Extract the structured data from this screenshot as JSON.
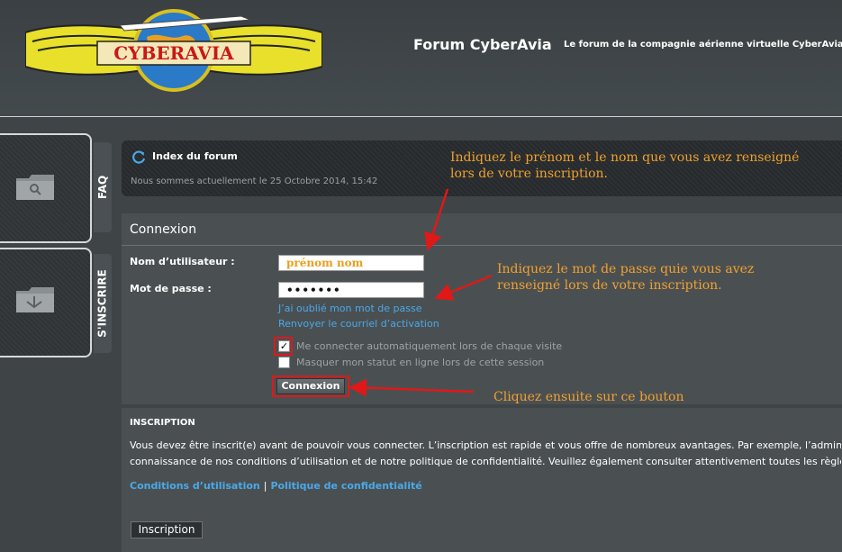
{
  "header": {
    "logo_text": "CYBERAVIA",
    "site_title": "Forum CyberAvia",
    "site_description": "Le forum de la compagnie aérienne virtuelle CyberAvia"
  },
  "side_tabs": [
    {
      "label": "FAQ",
      "icon": "search-folder-icon"
    },
    {
      "label": "S'INSCRIRE",
      "icon": "inbox-folder-icon"
    }
  ],
  "nav": {
    "icon": "refresh-icon",
    "index_link": "Index du forum",
    "date_text": "Nous sommes actuellement le 25 Octobre 2014, 15:42"
  },
  "login": {
    "title": "Connexion",
    "username_label": "Nom d’utilisateur :",
    "username_value": "prénom nom",
    "password_label": "Mot de passe :",
    "password_value": "•••••••",
    "forgot_link": "J’ai oublié mon mot de passe",
    "resend_link": "Renvoyer le courriel d’activation",
    "remember_label": "Me connecter automatiquement lors de chaque visite",
    "remember_checked": true,
    "hide_label": "Masquer mon statut en ligne lors de cette session",
    "hide_checked": false,
    "submit_label": "Connexion"
  },
  "register": {
    "title": "INSCRIPTION",
    "text_line1": "Vous devez être inscrit(e) avant de pouvoir vous connecter. L’inscription est rapide et vous offre de nombreux avantages. Par exemple, l’administ",
    "text_line2": "connaissance de nos conditions d’utilisation et de notre politique de confidentialité. Veuillez également consulter attentivement toutes les règles",
    "terms_link": "Conditions d’utilisation",
    "separator": "|",
    "privacy_link": "Politique de confidentialité",
    "button_label": "Inscription"
  },
  "annotations": {
    "name_hint_line1": "Indiquez le prénom et le nom que vous avez renseigné",
    "name_hint_line2": "lors de votre inscription.",
    "password_hint_line1": "Indiquez le mot de passe quie vous avez",
    "password_hint_line2": "renseigné lors de votre inscription.",
    "button_hint": "Cliquez ensuite sur ce bouton"
  },
  "colors": {
    "annotation": "#f0a030",
    "highlight": "#e01818",
    "link": "#4aa8e8"
  }
}
